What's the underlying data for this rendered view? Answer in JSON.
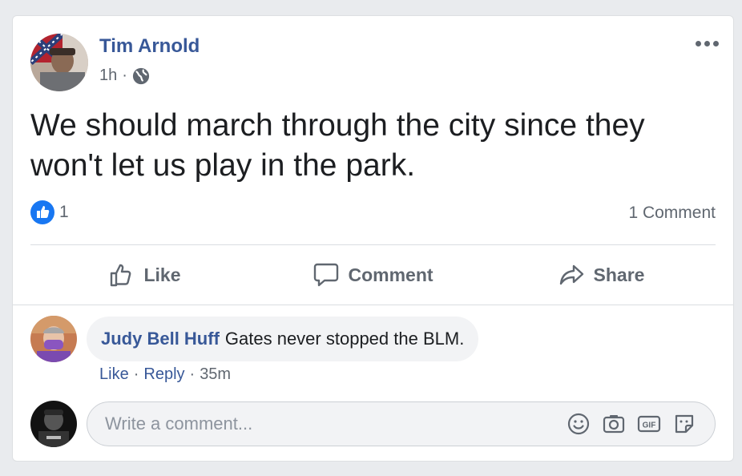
{
  "post": {
    "author": "Tim Arnold",
    "time": "1h",
    "separator": "·",
    "text": "We should march through the city since they won't let us play in the park.",
    "like_count": "1",
    "comment_count": "1 Comment"
  },
  "actions": {
    "like": "Like",
    "comment": "Comment",
    "share": "Share"
  },
  "comment": {
    "author": "Judy Bell Huff",
    "text": "Gates never stopped the BLM.",
    "like": "Like",
    "reply": "Reply",
    "time": "35m",
    "sep": "·"
  },
  "composer": {
    "placeholder": "Write a comment..."
  },
  "icons": [
    "globe-icon",
    "more-icon",
    "like-reaction-icon",
    "thumbs-up-icon",
    "comment-icon",
    "share-icon",
    "emoji-icon",
    "camera-icon",
    "gif-icon",
    "sticker-icon"
  ],
  "colors": {
    "link": "#385898",
    "secondary": "#606770",
    "like_blue": "#1877f2"
  }
}
